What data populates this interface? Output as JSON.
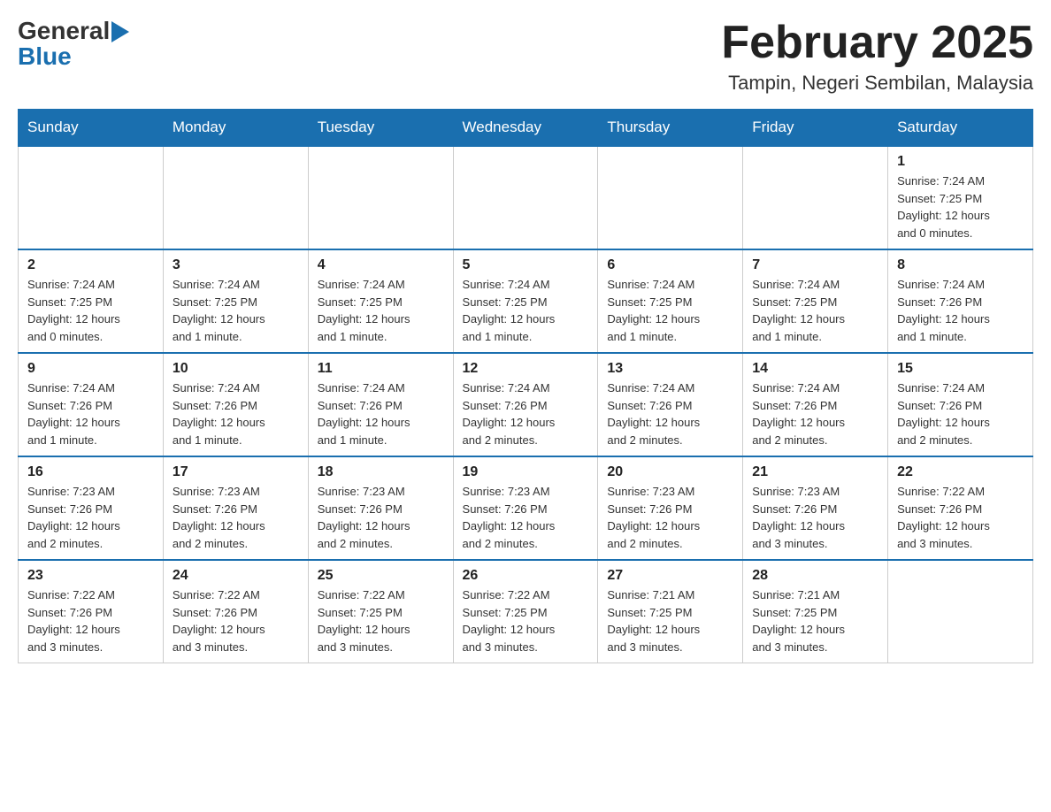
{
  "logo": {
    "general": "General",
    "blue": "Blue"
  },
  "title": "February 2025",
  "location": "Tampin, Negeri Sembilan, Malaysia",
  "days_of_week": [
    "Sunday",
    "Monday",
    "Tuesday",
    "Wednesday",
    "Thursday",
    "Friday",
    "Saturday"
  ],
  "weeks": [
    [
      {
        "day": "",
        "info": ""
      },
      {
        "day": "",
        "info": ""
      },
      {
        "day": "",
        "info": ""
      },
      {
        "day": "",
        "info": ""
      },
      {
        "day": "",
        "info": ""
      },
      {
        "day": "",
        "info": ""
      },
      {
        "day": "1",
        "info": "Sunrise: 7:24 AM\nSunset: 7:25 PM\nDaylight: 12 hours\nand 0 minutes."
      }
    ],
    [
      {
        "day": "2",
        "info": "Sunrise: 7:24 AM\nSunset: 7:25 PM\nDaylight: 12 hours\nand 0 minutes."
      },
      {
        "day": "3",
        "info": "Sunrise: 7:24 AM\nSunset: 7:25 PM\nDaylight: 12 hours\nand 1 minute."
      },
      {
        "day": "4",
        "info": "Sunrise: 7:24 AM\nSunset: 7:25 PM\nDaylight: 12 hours\nand 1 minute."
      },
      {
        "day": "5",
        "info": "Sunrise: 7:24 AM\nSunset: 7:25 PM\nDaylight: 12 hours\nand 1 minute."
      },
      {
        "day": "6",
        "info": "Sunrise: 7:24 AM\nSunset: 7:25 PM\nDaylight: 12 hours\nand 1 minute."
      },
      {
        "day": "7",
        "info": "Sunrise: 7:24 AM\nSunset: 7:25 PM\nDaylight: 12 hours\nand 1 minute."
      },
      {
        "day": "8",
        "info": "Sunrise: 7:24 AM\nSunset: 7:26 PM\nDaylight: 12 hours\nand 1 minute."
      }
    ],
    [
      {
        "day": "9",
        "info": "Sunrise: 7:24 AM\nSunset: 7:26 PM\nDaylight: 12 hours\nand 1 minute."
      },
      {
        "day": "10",
        "info": "Sunrise: 7:24 AM\nSunset: 7:26 PM\nDaylight: 12 hours\nand 1 minute."
      },
      {
        "day": "11",
        "info": "Sunrise: 7:24 AM\nSunset: 7:26 PM\nDaylight: 12 hours\nand 1 minute."
      },
      {
        "day": "12",
        "info": "Sunrise: 7:24 AM\nSunset: 7:26 PM\nDaylight: 12 hours\nand 2 minutes."
      },
      {
        "day": "13",
        "info": "Sunrise: 7:24 AM\nSunset: 7:26 PM\nDaylight: 12 hours\nand 2 minutes."
      },
      {
        "day": "14",
        "info": "Sunrise: 7:24 AM\nSunset: 7:26 PM\nDaylight: 12 hours\nand 2 minutes."
      },
      {
        "day": "15",
        "info": "Sunrise: 7:24 AM\nSunset: 7:26 PM\nDaylight: 12 hours\nand 2 minutes."
      }
    ],
    [
      {
        "day": "16",
        "info": "Sunrise: 7:23 AM\nSunset: 7:26 PM\nDaylight: 12 hours\nand 2 minutes."
      },
      {
        "day": "17",
        "info": "Sunrise: 7:23 AM\nSunset: 7:26 PM\nDaylight: 12 hours\nand 2 minutes."
      },
      {
        "day": "18",
        "info": "Sunrise: 7:23 AM\nSunset: 7:26 PM\nDaylight: 12 hours\nand 2 minutes."
      },
      {
        "day": "19",
        "info": "Sunrise: 7:23 AM\nSunset: 7:26 PM\nDaylight: 12 hours\nand 2 minutes."
      },
      {
        "day": "20",
        "info": "Sunrise: 7:23 AM\nSunset: 7:26 PM\nDaylight: 12 hours\nand 2 minutes."
      },
      {
        "day": "21",
        "info": "Sunrise: 7:23 AM\nSunset: 7:26 PM\nDaylight: 12 hours\nand 3 minutes."
      },
      {
        "day": "22",
        "info": "Sunrise: 7:22 AM\nSunset: 7:26 PM\nDaylight: 12 hours\nand 3 minutes."
      }
    ],
    [
      {
        "day": "23",
        "info": "Sunrise: 7:22 AM\nSunset: 7:26 PM\nDaylight: 12 hours\nand 3 minutes."
      },
      {
        "day": "24",
        "info": "Sunrise: 7:22 AM\nSunset: 7:26 PM\nDaylight: 12 hours\nand 3 minutes."
      },
      {
        "day": "25",
        "info": "Sunrise: 7:22 AM\nSunset: 7:25 PM\nDaylight: 12 hours\nand 3 minutes."
      },
      {
        "day": "26",
        "info": "Sunrise: 7:22 AM\nSunset: 7:25 PM\nDaylight: 12 hours\nand 3 minutes."
      },
      {
        "day": "27",
        "info": "Sunrise: 7:21 AM\nSunset: 7:25 PM\nDaylight: 12 hours\nand 3 minutes."
      },
      {
        "day": "28",
        "info": "Sunrise: 7:21 AM\nSunset: 7:25 PM\nDaylight: 12 hours\nand 3 minutes."
      },
      {
        "day": "",
        "info": ""
      }
    ]
  ]
}
